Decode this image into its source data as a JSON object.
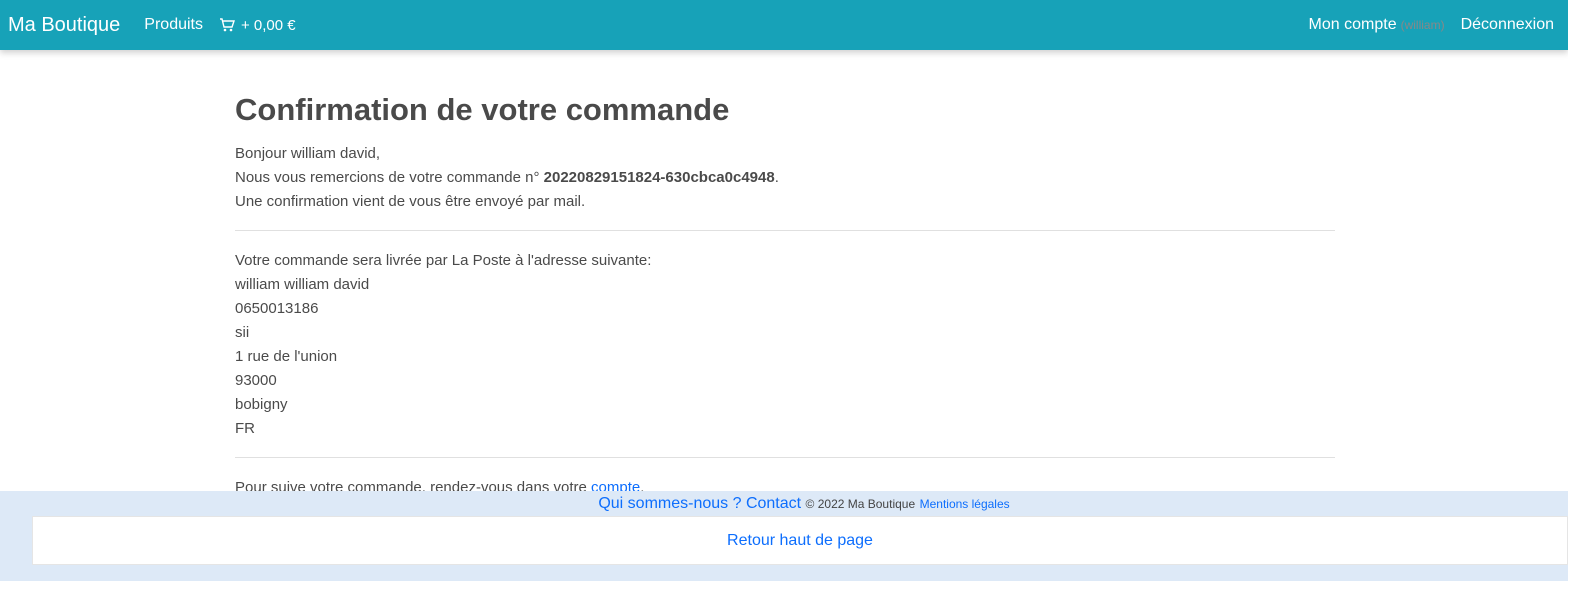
{
  "navbar": {
    "brand": "Ma Boutique",
    "products": "Produits",
    "cart_amount": "+ 0,00 €",
    "account": "Mon compte",
    "account_user": "(william)",
    "logout": "Déconnexion"
  },
  "content": {
    "title": "Confirmation de votre commande",
    "greeting": "Bonjour william david,",
    "thanks_prefix": "Nous vous remercions de votre commande n° ",
    "order_number": "20220829151824-630cbca0c4948",
    "thanks_suffix": ".",
    "mail_confirmation": "Une confirmation vient de vous être envoyé par mail.",
    "delivery_intro": "Votre commande sera livrée par La Poste à l'adresse suivante:",
    "address": [
      "william william david",
      "0650013186",
      "sii",
      "1 rue de l'union",
      "93000",
      "bobigny",
      "FR"
    ],
    "follow_prefix": "Pour suive votre commande, rendez-vous dans votre ",
    "follow_link": "compte",
    "follow_suffix": "."
  },
  "footer": {
    "about": "Qui sommes-nous ?",
    "contact": "Contact",
    "copyright": "© 2022 Ma Boutique",
    "legal": "Mentions légales",
    "back_to_top": "Retour haut de page"
  },
  "colors": {
    "navbar": "#17a2b8",
    "link": "#0d6efd",
    "footer": "#dde9f7"
  },
  "icons": {
    "cart": "cart-icon"
  }
}
